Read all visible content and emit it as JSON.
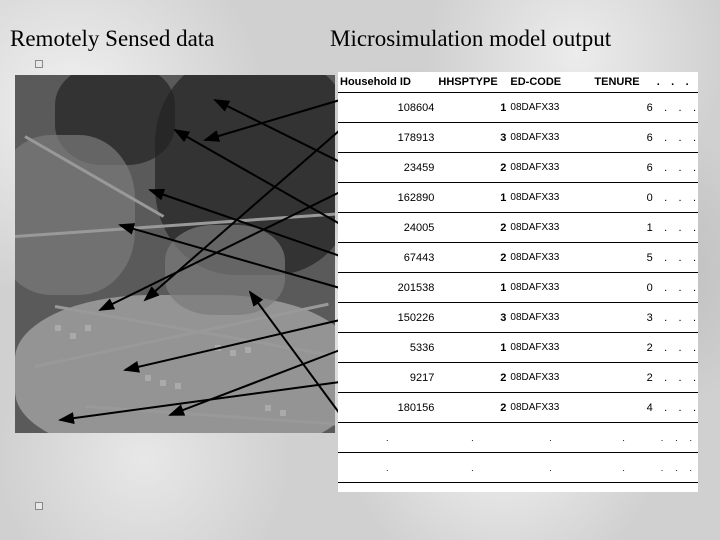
{
  "titles": {
    "left": "Remotely Sensed data",
    "right": "Microsimulation model output"
  },
  "table": {
    "headers": [
      "Household ID",
      "HHSPTYPE",
      "ED-CODE",
      "TENURE"
    ],
    "rows": [
      {
        "id": "108604",
        "type": "1",
        "code": "08DAFX33",
        "tenure": "6"
      },
      {
        "id": "178913",
        "type": "3",
        "code": "08DAFX33",
        "tenure": "6"
      },
      {
        "id": "23459",
        "type": "2",
        "code": "08DAFX33",
        "tenure": "6"
      },
      {
        "id": "162890",
        "type": "1",
        "code": "08DAFX33",
        "tenure": "0"
      },
      {
        "id": "24005",
        "type": "2",
        "code": "08DAFX33",
        "tenure": "1"
      },
      {
        "id": "67443",
        "type": "2",
        "code": "08DAFX33",
        "tenure": "5"
      },
      {
        "id": "201538",
        "type": "1",
        "code": "08DAFX33",
        "tenure": "0"
      },
      {
        "id": "150226",
        "type": "3",
        "code": "08DAFX33",
        "tenure": "3"
      },
      {
        "id": "5336",
        "type": "1",
        "code": "08DAFX33",
        "tenure": "2"
      },
      {
        "id": "9217",
        "type": "2",
        "code": "08DAFX33",
        "tenure": "2"
      },
      {
        "id": "180156",
        "type": "2",
        "code": "08DAFX33",
        "tenure": "4"
      }
    ],
    "ellipsis": ". . ."
  }
}
